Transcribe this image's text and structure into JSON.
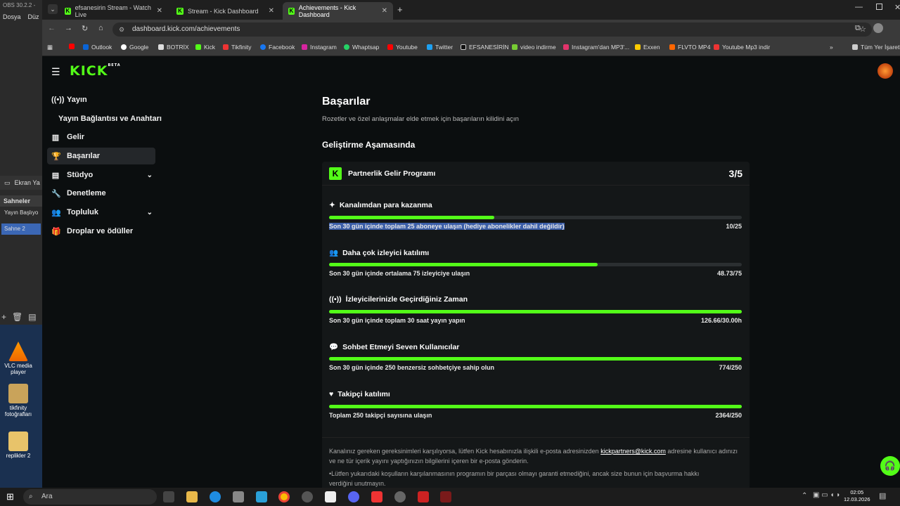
{
  "obs": {
    "title": "OBS 30.2.2 -",
    "menu": [
      "Dosya",
      "Düz"
    ],
    "ekran_label": "Ekran Ya",
    "scenes_header": "Sahneler",
    "scenes": [
      "Yayın Başlıyo",
      "Sahne 2"
    ],
    "desktop_icons": [
      "VLC media player",
      "tikfinity fotoğrafları",
      "replikler 2"
    ]
  },
  "browser": {
    "tabs": [
      {
        "label": "efsanesirin Stream - Watch Live"
      },
      {
        "label": "Stream - Kick Dashboard"
      },
      {
        "label": "Achievements - Kick Dashboard"
      }
    ],
    "url": "dashboard.kick.com/achievements",
    "bookmarks": [
      "Outlook",
      "Google",
      "BOTRİX",
      "Kick",
      "Tikfinity",
      "Facebook",
      "Instagram",
      "Whaptsap",
      "Youtube",
      "Twitter",
      "EFSANESİRİN",
      "video indirme",
      "Instagram'dan MP3'...",
      "Exxen",
      "FLVTO MP4",
      "Youtube Mp3 indir"
    ],
    "all_bookmarks": "Tüm Yer İşaretl"
  },
  "kick": {
    "logo": "KICK",
    "logo_beta": "BETA",
    "sidebar": [
      {
        "label": "Yayın",
        "icon": "broadcast-icon"
      },
      {
        "label": "Yayın Bağlantısı ve Anahtarı",
        "icon": ""
      },
      {
        "label": "Gelir",
        "icon": "chart-icon"
      },
      {
        "label": "Başarılar",
        "icon": "trophy-icon"
      },
      {
        "label": "Stüdyo",
        "icon": "studio-icon"
      },
      {
        "label": "Denetleme",
        "icon": "wrench-icon"
      },
      {
        "label": "Topluluk",
        "icon": "people-icon"
      },
      {
        "label": "Droplar ve ödüller",
        "icon": "gift-icon"
      }
    ],
    "page_title": "Başarılar",
    "page_subtitle": "Rozetler ve özel anlaşmalar elde etmek için başarıların kilidini açın",
    "section_title": "Geliştirme Aşamasında",
    "program": {
      "name": "Partnerlik Gelir Programı",
      "progress": "3/5"
    },
    "achievements": [
      {
        "title": "Kanalımdan para kazanma",
        "desc": "Son 30 gün içinde toplam 25 aboneye ulaşın (hediye abonelikler dahil değildir)",
        "progress": "10/25",
        "fraction": 0.4
      },
      {
        "title": "Daha çok izleyici katılımı",
        "desc": "Son 30 gün içinde ortalama 75 izleyiciye ulaşın",
        "progress": "48.73/75",
        "fraction": 0.65
      },
      {
        "title": "İzleyicilerinizle Geçirdiğiniz Zaman",
        "desc": "Son 30 gün içinde toplam 30 saat yayın yapın",
        "progress": "126.66/30.00h",
        "fraction": 1.0
      },
      {
        "title": "Sohbet Etmeyi Seven Kullanıcılar",
        "desc": "Son 30 gün içinde 250 benzersiz sohbetçiye sahip olun",
        "progress": "774/250",
        "fraction": 1.0
      },
      {
        "title": "Takipçi katılımı",
        "desc": "Toplam 250 takipçi sayısına ulaşın",
        "progress": "2364/250",
        "fraction": 1.0
      }
    ],
    "footer_text1": "Kanalınız gereken gereksinimleri karşılıyorsa, lütfen Kick hesabınızla ilişkili e-posta adresinizden",
    "footer_email": "kickpartners@kick.com",
    "footer_text2": "adresine",
    "footer_text3": "kullanıcı adınızı ve ne tür içerik yayını yaptığınızın bilgilerini içeren bir e-posta gönderin.",
    "footer_note1": "•Lütfen yukarıdaki koşulların karşılanmasının programın bir parçası olmayı garanti etmediğini, ancak size bunun için başvurma hakkı",
    "footer_note2": "verdiğini unutmayın."
  },
  "taskbar": {
    "search_placeholder": "Ara",
    "time": "02:05",
    "date": "12.03.2026"
  },
  "colors": {
    "accent": "#53fc18",
    "background": "#0b0e0f",
    "card": "#141718"
  }
}
